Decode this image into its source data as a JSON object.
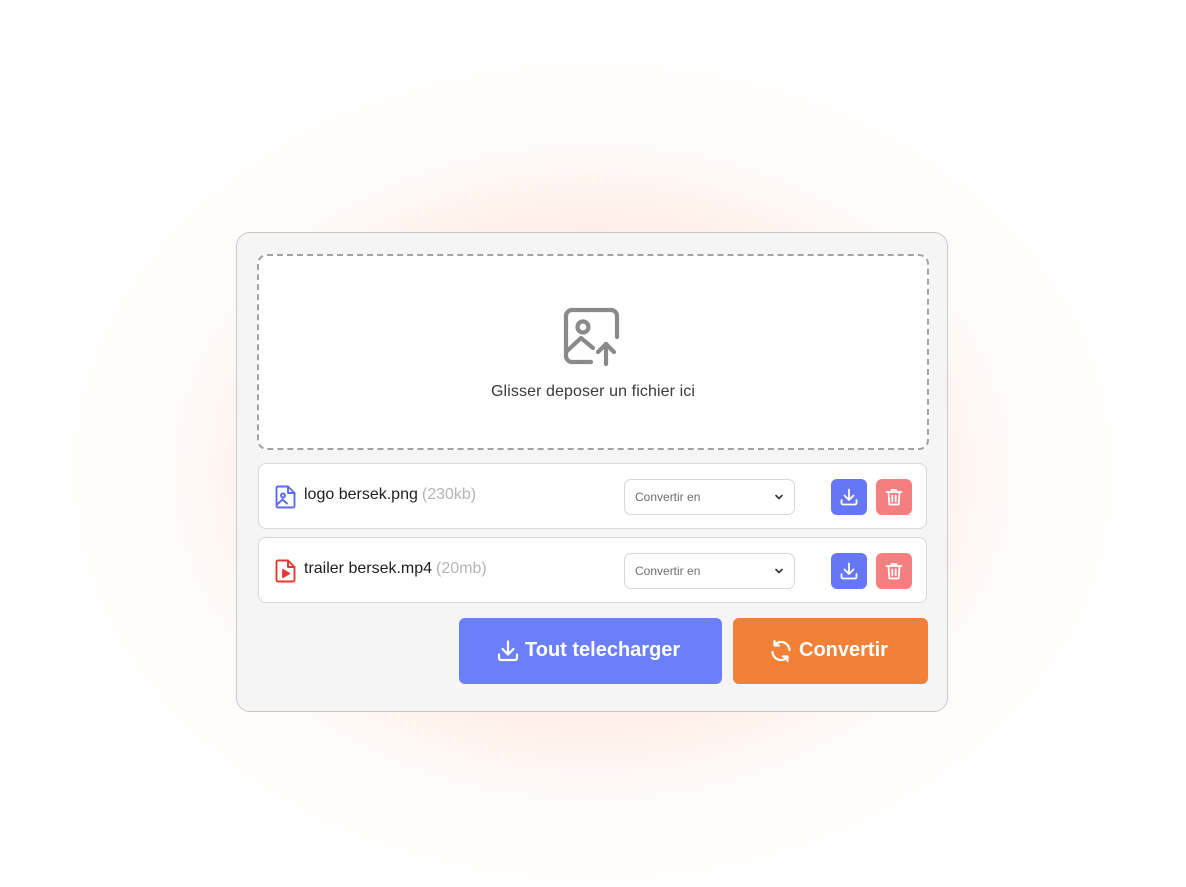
{
  "dropzone": {
    "icon": "image-upload-icon",
    "text": "Glisser deposer un fichier ici"
  },
  "files": [
    {
      "name": "logo bersek.png",
      "size": "(230kb)",
      "icon": "image-file-icon",
      "icon_color": "#5b6cf2",
      "select_placeholder": "Convertir en"
    },
    {
      "name": "trailer bersek.mp4",
      "size": "(20mb)",
      "icon": "video-file-icon",
      "icon_color": "#e53935",
      "select_placeholder": "Convertir en"
    }
  ],
  "actions": {
    "download_all_label": "Tout telecharger",
    "convert_label": "Convertir"
  },
  "colors": {
    "accent_blue": "#6b7ffb",
    "accent_orange": "#f28137",
    "delete_red": "#f57f7f"
  }
}
